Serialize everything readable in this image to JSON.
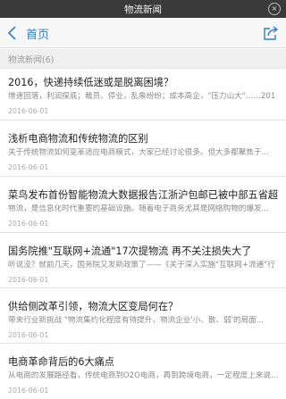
{
  "window": {
    "title": "物流新闻",
    "close_glyph": "×"
  },
  "navbar": {
    "back_label": "首页",
    "accent_color": "#2d7fd6"
  },
  "section": {
    "label": "物流新闻(6)"
  },
  "articles": [
    {
      "title": "2016，快递持续低迷或是脱离困境？",
      "summary": "增速回落，利润探底；裁员、停业，乱象纷纷；成本高企，\"压力山大\"……201",
      "date": "2016-06-01"
    },
    {
      "title": "浅析电商物流和传统物流的区别",
      "summary": "关于传统物流如何变革适应电商模式，大家已经讨论很多。但大多都聚焦于...",
      "date": "2016-06-01"
    },
    {
      "title": "菜鸟发布首份智能物流大数据报告江浙沪包邮已被中部五省超越",
      "summary": "物流，是信息化时代重要的基础设施。随着电子商务尤其是网络购物的爆发...",
      "date": "2016-06-01"
    },
    {
      "title": "国务院推\"互联网+流通\"17次提物流 再不关注损失大了",
      "summary": "听说没？就前几天，国务院又发新政策了——《关于深入实施\"互联网+流通\"行",
      "date": "2016-06-01"
    },
    {
      "title": "供给侧改革引领，物流大区变局何在？",
      "summary": "带来行业新挑战        \"物流集约化程度有待提升，物流企业'小、散、弱'的局面...",
      "date": "2016-06-01"
    },
    {
      "title": "电商革命背后的6大痛点",
      "summary": "从电商的发展路径看，传统电商到O2O电商，再到跨境电商，一定程度上来说...",
      "date": "2016-06-01"
    }
  ]
}
